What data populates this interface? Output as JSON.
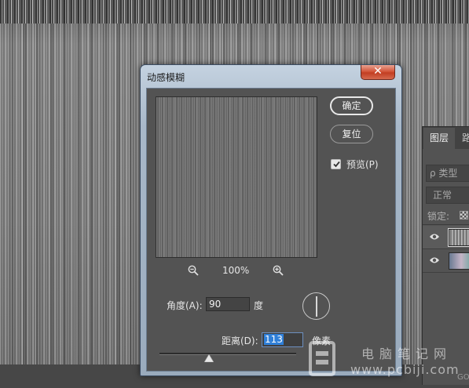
{
  "dialog": {
    "title": "动感模糊",
    "close_glyph": "✕",
    "ok_label": "确定",
    "reset_label": "复位",
    "preview_checked": true,
    "preview_label": "预览(P)",
    "zoom_level": "100%",
    "angle_label": "角度(A):",
    "angle_value": "90",
    "angle_unit": "度",
    "distance_label": "距离(D):",
    "distance_value": "113",
    "distance_unit": "像素"
  },
  "layers_panel": {
    "tab_active": "图层",
    "tab_next": "路",
    "search_placeholder": "ρ 类型",
    "blend_mode": "正常",
    "lock_label": "锁定:"
  },
  "watermark": {
    "title": "电脑笔记网",
    "url": "www.pcbiji.com"
  },
  "colors": {
    "dialog_panel": "#535353",
    "close_button": "#c9452a",
    "selection": "#2f7fd8"
  }
}
